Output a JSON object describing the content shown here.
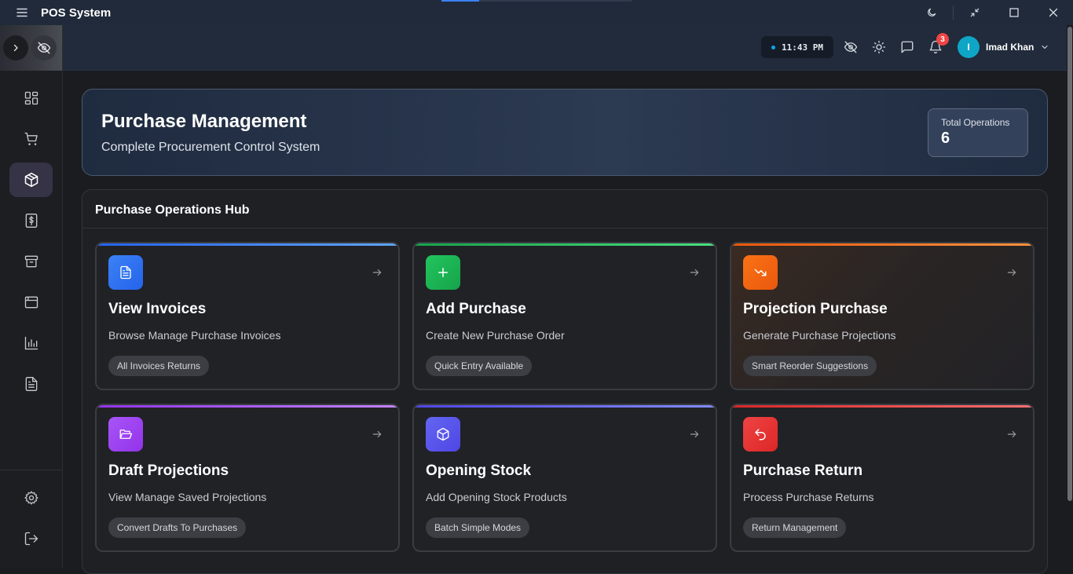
{
  "titlebar": {
    "app_title": "POS System"
  },
  "header": {
    "time": "11:43 PM",
    "notification_count": "3",
    "user": {
      "initial": "I",
      "name": "Imad Khan"
    }
  },
  "hero": {
    "title": "Purchase Management",
    "subtitle": "Complete Procurement Control System",
    "stat_label": "Total Operations",
    "stat_value": "6"
  },
  "hub": {
    "title": "Purchase Operations Hub",
    "cards": [
      {
        "title": "View Invoices",
        "description": "Browse Manage Purchase Invoices",
        "tag": "All Invoices Returns",
        "icon": "document-icon",
        "accent": "#3b82f6"
      },
      {
        "title": "Add Purchase",
        "description": "Create New Purchase Order",
        "tag": "Quick Entry Available",
        "icon": "plus-icon",
        "accent": "#22c55e"
      },
      {
        "title": "Projection Purchase",
        "description": "Generate Purchase Projections",
        "tag": "Smart Reorder Suggestions",
        "icon": "trending-down-icon",
        "accent": "#f97316"
      },
      {
        "title": "Draft Projections",
        "description": "View Manage Saved Projections",
        "tag": "Convert Drafts To Purchases",
        "icon": "folder-open-icon",
        "accent": "#a855f7"
      },
      {
        "title": "Opening Stock",
        "description": "Add Opening Stock Products",
        "tag": "Batch Simple Modes",
        "icon": "box-icon",
        "accent": "#6366f1"
      },
      {
        "title": "Purchase Return",
        "description": "Process Purchase Returns",
        "tag": "Return Management",
        "icon": "undo-icon",
        "accent": "#ef4444"
      }
    ]
  },
  "colors": {
    "accent_blue": "#3b82f6",
    "accent_green": "#22c55e",
    "accent_orange": "#f97316",
    "accent_purple": "#a855f7",
    "accent_indigo": "#6366f1",
    "accent_red": "#ef4444",
    "avatar": "#0ea5c6"
  }
}
